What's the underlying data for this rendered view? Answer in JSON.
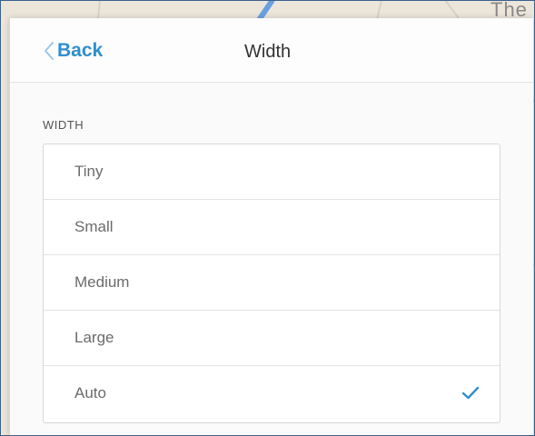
{
  "header": {
    "back_label": "Back",
    "title": "Width"
  },
  "section": {
    "label": "WIDTH"
  },
  "options": [
    {
      "label": "Tiny",
      "selected": false
    },
    {
      "label": "Small",
      "selected": false
    },
    {
      "label": "Medium",
      "selected": false
    },
    {
      "label": "Large",
      "selected": false
    },
    {
      "label": "Auto",
      "selected": true
    }
  ],
  "map": {
    "visible_label": "The"
  },
  "colors": {
    "accent": "#2f8fcf",
    "check": "#2f8fcf",
    "frame_border": "#39608e"
  },
  "icons": {
    "back": "chevron-left-icon",
    "selected": "check-icon"
  }
}
